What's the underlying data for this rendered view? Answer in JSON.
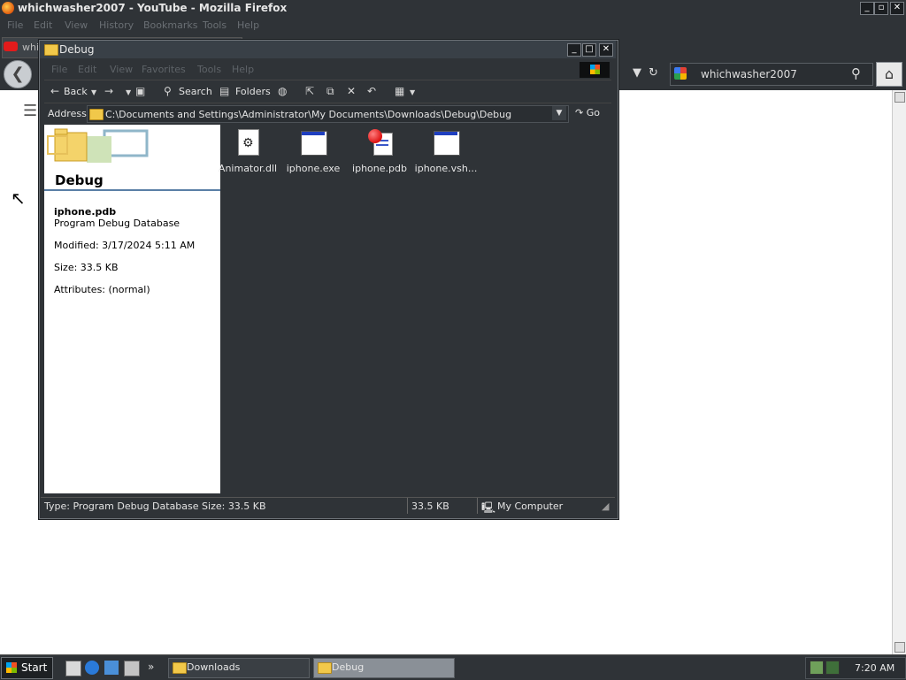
{
  "firefox": {
    "title": "whichwasher2007 - YouTube - Mozilla Firefox",
    "menu": [
      "File",
      "Edit",
      "View",
      "History",
      "Bookmarks",
      "Tools",
      "Help"
    ],
    "tab_label": "whic",
    "search_value": "whichwasher2007"
  },
  "explorer": {
    "title": "Debug",
    "menu": [
      "File",
      "Edit",
      "View",
      "Favorites",
      "Tools",
      "Help"
    ],
    "toolbar": {
      "back": "Back",
      "search": "Search",
      "folders": "Folders"
    },
    "address_label": "Address",
    "address_value": "C:\\Documents and Settings\\Administrator\\My Documents\\Downloads\\Debug\\Debug",
    "go_label": "Go",
    "details": {
      "folder_title": "Debug",
      "file_name": "iphone.pdb",
      "file_type": "Program Debug Database",
      "modified": "Modified: 3/17/2024 5:11 AM",
      "size": "Size: 33.5 KB",
      "attributes": "Attributes: (normal)"
    },
    "files": [
      {
        "name": "Animator.dll",
        "icon": "dll-gear-icon"
      },
      {
        "name": "iphone.exe",
        "icon": "exe-window-icon"
      },
      {
        "name": "iphone.pdb",
        "icon": "pdb-icon"
      },
      {
        "name": "iphone.vsh...",
        "icon": "window-file-icon"
      }
    ],
    "status": {
      "info": "Type: Program Debug Database Size: 33.5 KB",
      "size": "33.5 KB",
      "zone": "My Computer"
    }
  },
  "taskbar": {
    "start": "Start",
    "tasks": [
      "Downloads",
      "Debug"
    ],
    "clock": "7:20 AM"
  }
}
